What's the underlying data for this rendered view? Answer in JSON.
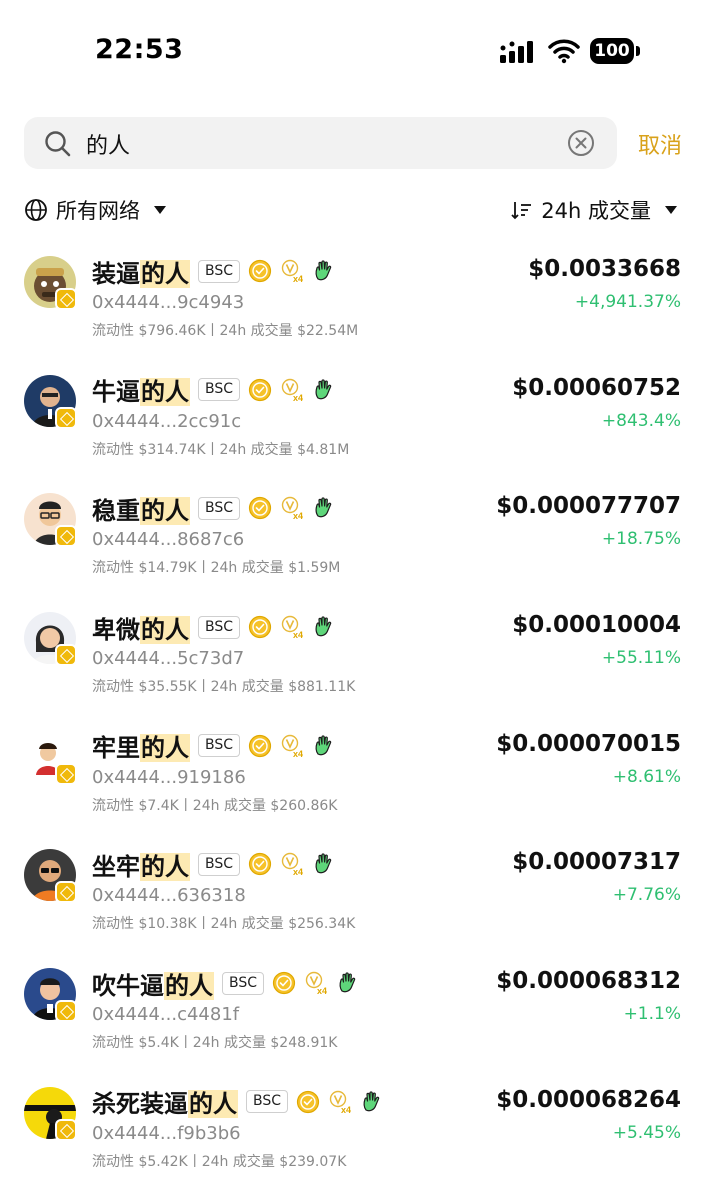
{
  "status_bar": {
    "time": "22:53",
    "battery": "100"
  },
  "search": {
    "query": "的人",
    "cancel_label": "取消"
  },
  "filters": {
    "network_label": "所有网络",
    "sort_label": "24h 成交量"
  },
  "colors": {
    "accent": "#d9a21b",
    "positive": "#2fbf71",
    "highlight": "#fdeab3",
    "bnb": "#f0b90b"
  },
  "tokens": [
    {
      "name_prefix": "装逼",
      "name_match": "的人",
      "chain": "BSC",
      "address": "0x4444...9c4943",
      "meta": "流动性 $796.46K丨24h 成交量 $22.54M",
      "price": "$0.0033668",
      "change": "+4,941.37%"
    },
    {
      "name_prefix": "牛逼",
      "name_match": "的人",
      "chain": "BSC",
      "address": "0x4444...2cc91c",
      "meta": "流动性 $314.74K丨24h 成交量 $4.81M",
      "price": "$0.00060752",
      "change": "+843.4%"
    },
    {
      "name_prefix": "稳重",
      "name_match": "的人",
      "chain": "BSC",
      "address": "0x4444...8687c6",
      "meta": "流动性 $14.79K丨24h 成交量 $1.59M",
      "price": "$0.000077707",
      "change": "+18.75%"
    },
    {
      "name_prefix": "卑微",
      "name_match": "的人",
      "chain": "BSC",
      "address": "0x4444...5c73d7",
      "meta": "流动性 $35.55K丨24h 成交量 $881.11K",
      "price": "$0.00010004",
      "change": "+55.11%"
    },
    {
      "name_prefix": "牢里",
      "name_match": "的人",
      "chain": "BSC",
      "address": "0x4444...919186",
      "meta": "流动性 $7.4K丨24h 成交量 $260.86K",
      "price": "$0.000070015",
      "change": "+8.61%"
    },
    {
      "name_prefix": "坐牢",
      "name_match": "的人",
      "chain": "BSC",
      "address": "0x4444...636318",
      "meta": "流动性 $10.38K丨24h 成交量 $256.34K",
      "price": "$0.00007317",
      "change": "+7.76%"
    },
    {
      "name_prefix": "吹牛逼",
      "name_match": "的人",
      "chain": "BSC",
      "address": "0x4444...c4481f",
      "meta": "流动性 $5.4K丨24h 成交量 $248.91K",
      "price": "$0.000068312",
      "change": "+1.1%"
    },
    {
      "name_prefix": "杀死装逼",
      "name_match": "的人",
      "chain": "BSC",
      "address": "0x4444...f9b3b6",
      "meta": "流动性 $5.42K丨24h 成交量 $239.07K",
      "price": "$0.000068264",
      "change": "+5.45%"
    }
  ]
}
